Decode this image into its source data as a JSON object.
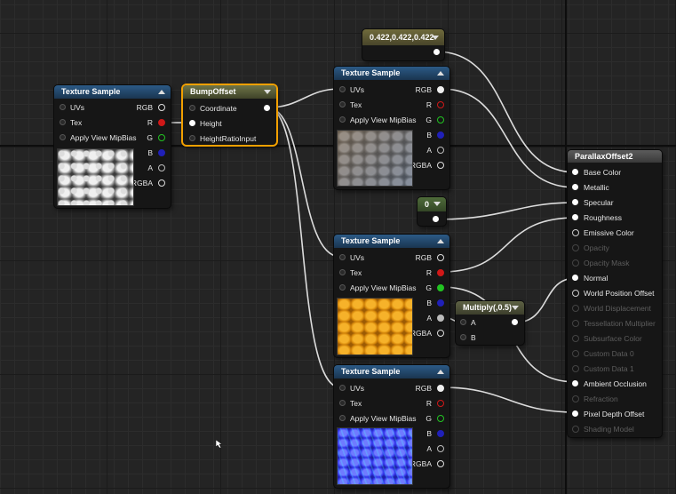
{
  "tex1": {
    "title": "Texture Sample",
    "inputs": [
      "UVs",
      "Tex",
      "Apply View MipBias"
    ],
    "outputs": [
      "RGB",
      "R",
      "G",
      "B",
      "A",
      "RGBA"
    ]
  },
  "bump": {
    "title": "BumpOffset",
    "inputs": [
      "Coordinate",
      "Height",
      "HeightRatioInput"
    ]
  },
  "const3": {
    "value": "0.422,0.422,0.422"
  },
  "tex2": {
    "title": "Texture Sample",
    "inputs": [
      "UVs",
      "Tex",
      "Apply View MipBias"
    ],
    "outputs": [
      "RGB",
      "R",
      "G",
      "B",
      "A",
      "RGBA"
    ]
  },
  "const1": {
    "value": "0"
  },
  "tex3": {
    "title": "Texture Sample",
    "inputs": [
      "UVs",
      "Tex",
      "Apply View MipBias"
    ],
    "outputs": [
      "RGB",
      "R",
      "G",
      "B",
      "A",
      "RGBA"
    ]
  },
  "tex4": {
    "title": "Texture Sample",
    "inputs": [
      "UVs",
      "Tex",
      "Apply View MipBias"
    ],
    "outputs": [
      "RGB",
      "R",
      "G",
      "B",
      "A",
      "RGBA"
    ]
  },
  "multiply": {
    "title": "Multiply(,0.5)",
    "inputs": [
      "A",
      "B"
    ]
  },
  "material": {
    "title": "ParallaxOffset2",
    "pins": [
      "Base Color",
      "Metallic",
      "Specular",
      "Roughness",
      "Emissive Color",
      "Opacity",
      "Opacity Mask",
      "Normal",
      "World Position Offset",
      "World Displacement",
      "Tessellation Multiplier",
      "Subsurface Color",
      "Custom Data 0",
      "Custom Data 1",
      "Ambient Occlusion",
      "Refraction",
      "Pixel Depth Offset",
      "Shading Model"
    ]
  },
  "colors": {
    "r": "#d01818",
    "g": "#22c422",
    "b": "#2020b8",
    "wire": "#e8e8e8"
  }
}
